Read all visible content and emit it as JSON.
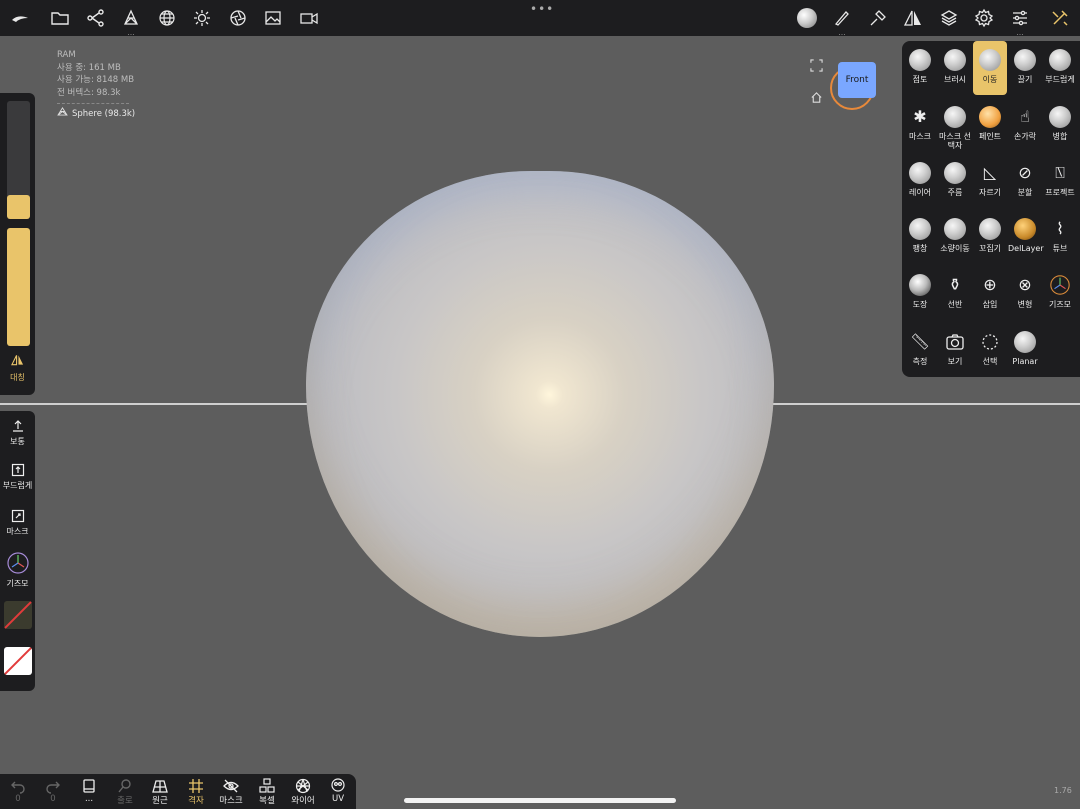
{
  "stats": {
    "ram": "RAM",
    "used": "사용 중: 161 MB",
    "available": "사용 가능: 8148 MB",
    "vertices": "전 버텍스: 98.3k",
    "object": "Sphere (98.3k)"
  },
  "viewcube": {
    "face": "Front"
  },
  "left": {
    "symmetry_label": "대칭",
    "normal_label": "보통",
    "smooth_label": "부드럽게",
    "mask_label": "마스크",
    "gizmo_label": "기즈모"
  },
  "tools": [
    {
      "label": "점토",
      "active": false
    },
    {
      "label": "브러시",
      "active": false
    },
    {
      "label": "이동",
      "active": true
    },
    {
      "label": "끌기",
      "active": false
    },
    {
      "label": "부드럽게",
      "active": false
    },
    {
      "label": "마스크",
      "active": false
    },
    {
      "label": "마스크 선택자",
      "active": false
    },
    {
      "label": "페인트",
      "active": false
    },
    {
      "label": "손가락",
      "active": false
    },
    {
      "label": "병합",
      "active": false
    },
    {
      "label": "레이어",
      "active": false
    },
    {
      "label": "주름",
      "active": false
    },
    {
      "label": "자르기",
      "active": false
    },
    {
      "label": "분할",
      "active": false
    },
    {
      "label": "프로젝트",
      "active": false
    },
    {
      "label": "팽창",
      "active": false
    },
    {
      "label": "소량이동",
      "active": false
    },
    {
      "label": "꼬집기",
      "active": false
    },
    {
      "label": "DelLayer",
      "active": false
    },
    {
      "label": "튜브",
      "active": false
    },
    {
      "label": "도장",
      "active": false
    },
    {
      "label": "선반",
      "active": false
    },
    {
      "label": "삽입",
      "active": false
    },
    {
      "label": "변형",
      "active": false
    },
    {
      "label": "기즈모",
      "active": false
    },
    {
      "label": "측정",
      "active": false
    },
    {
      "label": "보기",
      "active": false
    },
    {
      "label": "선택",
      "active": false
    },
    {
      "label": "Planar",
      "active": false
    }
  ],
  "bottom": {
    "undo_count": "0",
    "redo_count": "0",
    "dots": "...",
    "search": "출로",
    "perspective": "원근",
    "grid": "격자",
    "mask": "마스크",
    "duplicate": "복셀",
    "wireframe": "와이어",
    "uv": "UV"
  },
  "version": "1.76",
  "colors": {
    "accent": "#e9c46a",
    "panel": "#1d1d1f",
    "background": "#5d5d5d"
  }
}
